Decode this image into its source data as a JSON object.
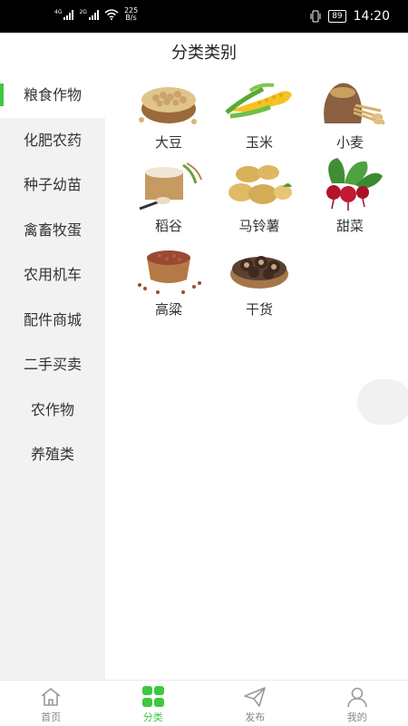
{
  "status": {
    "net1": "4G",
    "net2": "2G",
    "speed_value": "225",
    "speed_unit": "B/s",
    "battery": "89",
    "time": "14:20"
  },
  "header": {
    "title": "分类类别"
  },
  "sidebar": {
    "items": [
      {
        "label": "粮食作物",
        "active": true
      },
      {
        "label": "化肥农药"
      },
      {
        "label": "种子幼苗"
      },
      {
        "label": "禽畜牧蛋"
      },
      {
        "label": "农用机车"
      },
      {
        "label": "配件商城"
      },
      {
        "label": "二手买卖"
      },
      {
        "label": "农作物"
      },
      {
        "label": "养殖类"
      }
    ]
  },
  "grid": {
    "items": [
      {
        "label": "大豆",
        "icon": "soybean-icon"
      },
      {
        "label": "玉米",
        "icon": "corn-icon"
      },
      {
        "label": "小麦",
        "icon": "wheat-icon"
      },
      {
        "label": "稻谷",
        "icon": "rice-icon"
      },
      {
        "label": "马铃薯",
        "icon": "potato-icon"
      },
      {
        "label": "甜菜",
        "icon": "beet-icon"
      },
      {
        "label": "高粱",
        "icon": "sorghum-icon"
      },
      {
        "label": "干货",
        "icon": "dried-mushroom-icon"
      }
    ]
  },
  "tabs": [
    {
      "label": "首页",
      "icon": "home-icon"
    },
    {
      "label": "分类",
      "icon": "category-icon",
      "active": true
    },
    {
      "label": "发布",
      "icon": "send-icon"
    },
    {
      "label": "我的",
      "icon": "user-icon"
    }
  ],
  "colors": {
    "accent": "#3ec83e",
    "sidebar_bg": "#f2f2f2"
  }
}
